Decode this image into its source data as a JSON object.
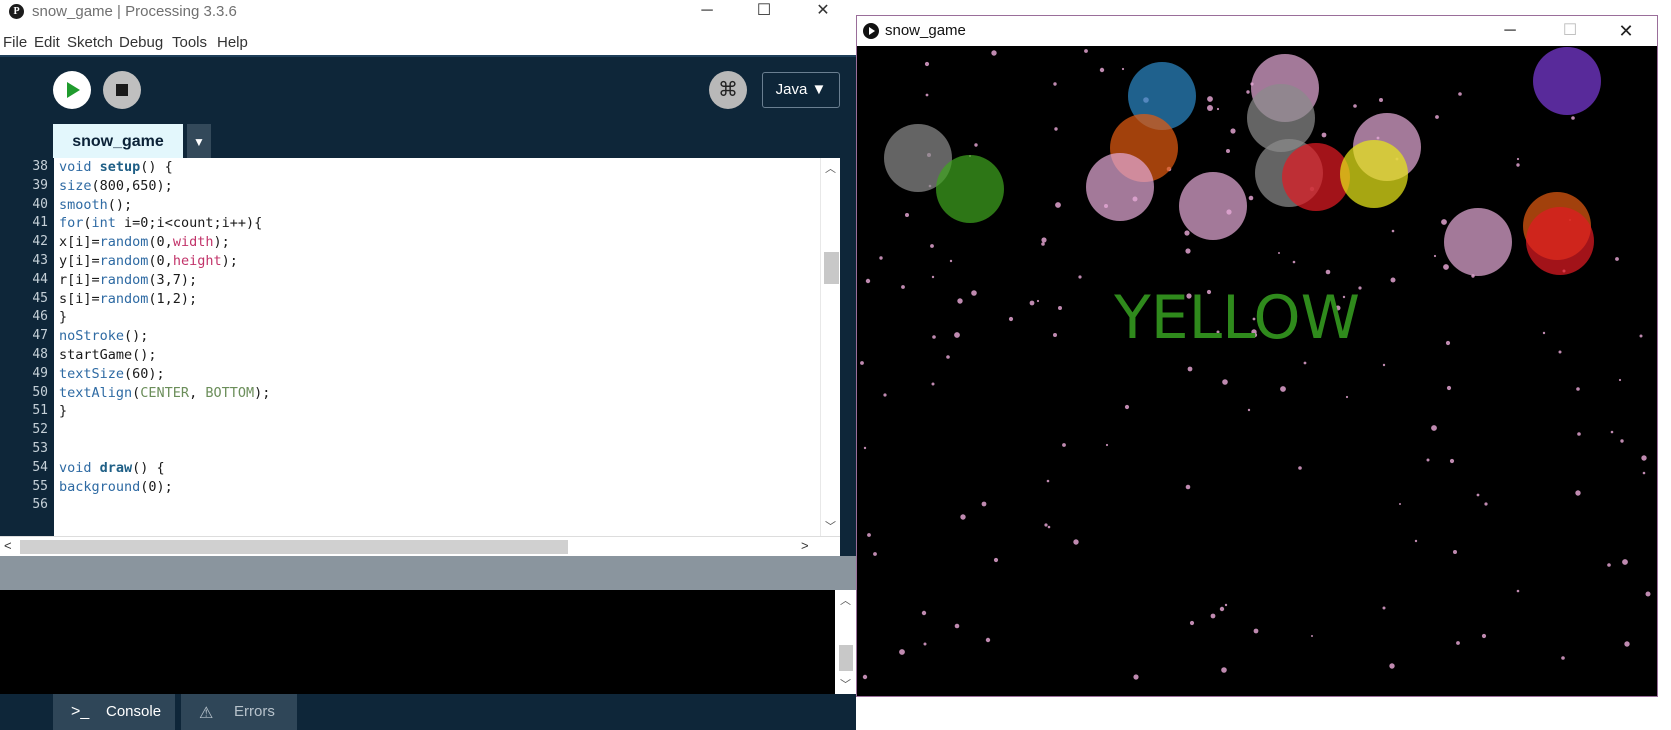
{
  "ide": {
    "title": "snow_game | Processing 3.3.6",
    "logo": "P",
    "window_controls": {
      "minimize": "─",
      "maximize": "☐",
      "close": "✕"
    },
    "menu": [
      "File",
      "Edit",
      "Sketch",
      "Debug",
      "Tools",
      "Help"
    ],
    "toolbar": {
      "run_icon": "play-icon",
      "stop_icon": "stop-icon",
      "debug_icon": "⌘",
      "mode": "Java ▼"
    },
    "tab": {
      "name": "snow_game",
      "menu_arrow": "▼"
    },
    "line_numbers": [
      "38",
      "39",
      "40",
      "41",
      "42",
      "43",
      "44",
      "45",
      "46",
      "47",
      "48",
      "49",
      "50",
      "51",
      "52",
      "53",
      "54",
      "55",
      "56"
    ],
    "code_lines": [
      "void setup() {",
      "size(800,650);",
      "smooth();",
      "for(int i=0;i<count;i++){",
      "x[i]=random(0,width);",
      "y[i]=random(0,height);",
      "r[i]=random(3,7);",
      "s[i]=random(1,2);",
      "}",
      "noStroke();",
      "startGame();",
      "textSize(60);",
      "textAlign(CENTER, BOTTOM);",
      "}",
      "",
      "",
      "void draw() {",
      "background(0);",
      ""
    ],
    "scroll_arrows": {
      "up": "︿",
      "down": "﹀",
      "left": "<",
      "right": ">"
    },
    "footer_tabs": {
      "console": "Console",
      "errors": "Errors",
      "console_icon": ">_",
      "errors_icon": "⚠"
    }
  },
  "sketch": {
    "title": "snow_game",
    "window_controls": {
      "minimize": "─",
      "maximize": "☐",
      "close": "✕"
    },
    "word": "YELLOW",
    "word_color": "#2f8a1c",
    "background": "#000000",
    "bubble_colors": {
      "gray": "#8a8a8a",
      "green": "#3ea31e",
      "blue": "#2b86c4",
      "orange": "#e05a10",
      "pink": "#e2a8d4",
      "red": "#e01a22",
      "yellow": "#e8e619",
      "purple": "#7a3ad6"
    },
    "snow_color": "#e0a2cf"
  }
}
